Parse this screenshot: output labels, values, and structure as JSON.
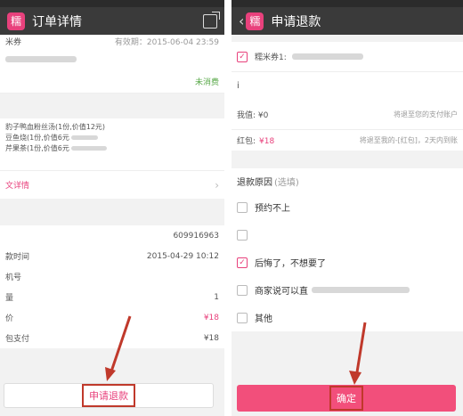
{
  "left": {
    "title": "订单详情",
    "coupon": {
      "name_fragment": "米券",
      "expiry": "有效期：2015-06-04  23:59",
      "status": "未消费"
    },
    "items": [
      "豹子鸭血粉丝汤(1份,价值12元)",
      "豆鱼烧(1份,价值6元",
      "芹果茶(1份,价值6元"
    ],
    "detail_link": "文详情",
    "info_rows": [
      {
        "label": "",
        "value": "609916963"
      },
      {
        "label": "款时间",
        "value": "2015-04-29 10:12"
      },
      {
        "label": "机号",
        "value": ""
      },
      {
        "label": "量",
        "value": "1"
      },
      {
        "label": "价",
        "value": "¥18"
      },
      {
        "label": "包支付",
        "value": "¥18"
      }
    ],
    "refund_button": "申请退款"
  },
  "right": {
    "title": "申请退款",
    "coupon_label": "糯米券1:",
    "mid_text": "i",
    "balance_label": "我值: ¥0",
    "balance_note": "将退至您的支付账户",
    "redpack_label": "红包:",
    "redpack_value": "¥18",
    "redpack_note": "将退至我的-[红包]，2天内到账",
    "reasons_title": "退款原因",
    "reasons_sub": "(选填)",
    "reasons": [
      {
        "label": "预约不上",
        "checked": false
      },
      {
        "label": "",
        "checked": false
      },
      {
        "label": "后悔了，不想要了",
        "checked": true
      },
      {
        "label": "商家说可以直",
        "checked": false
      },
      {
        "label": "其他",
        "checked": false
      }
    ],
    "confirm_button": "确定"
  },
  "logo_char": "糯",
  "colors": {
    "accent": "#e8417c",
    "button": "#f24f7b",
    "annotation": "#c0392b",
    "titlebar": "#3a3a3a"
  }
}
